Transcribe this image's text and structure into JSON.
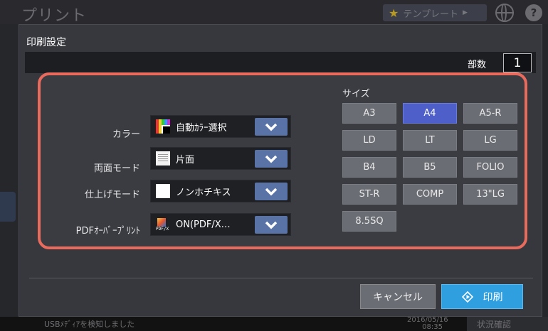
{
  "app": {
    "title": "プリント",
    "template_label": "テンプレート",
    "status_message": "USBﾒﾃﾞｨｱを検知しました",
    "status_date": "2016/05/16",
    "status_time": "08:35",
    "status_button": "状況確認"
  },
  "dialog": {
    "title": "印刷設定",
    "copies_label": "部数",
    "copies_value": "1"
  },
  "settings": [
    {
      "label": "カラー",
      "value": "自動ｶﾗｰ選択",
      "icon": "color-mode-icon"
    },
    {
      "label": "両面モード",
      "value": "片面",
      "icon": "simplex-icon"
    },
    {
      "label": "仕上げモード",
      "value": "ノンホチキス",
      "icon": "no-staple-icon"
    },
    {
      "label": "PDFｵｰﾊﾞｰﾌﾟﾘﾝﾄ",
      "value": "ON(PDF/X…",
      "icon": "pdf-icon",
      "icon_text": "PDF/X"
    }
  ],
  "size": {
    "label": "サイズ",
    "options": [
      "A3",
      "A4",
      "A5-R",
      "LD",
      "LT",
      "LG",
      "B4",
      "B5",
      "FOLIO",
      "ST-R",
      "COMP",
      "13\"LG",
      "8.5SQ"
    ],
    "selected": "A4"
  },
  "actions": {
    "cancel": "キャンセル",
    "print": "印刷"
  },
  "colors": {
    "accent_selected": "#4e5fc9",
    "print_button": "#2f9fe0",
    "highlight_border": "#e86b5e",
    "dropdown_button": "#5a73a6"
  }
}
